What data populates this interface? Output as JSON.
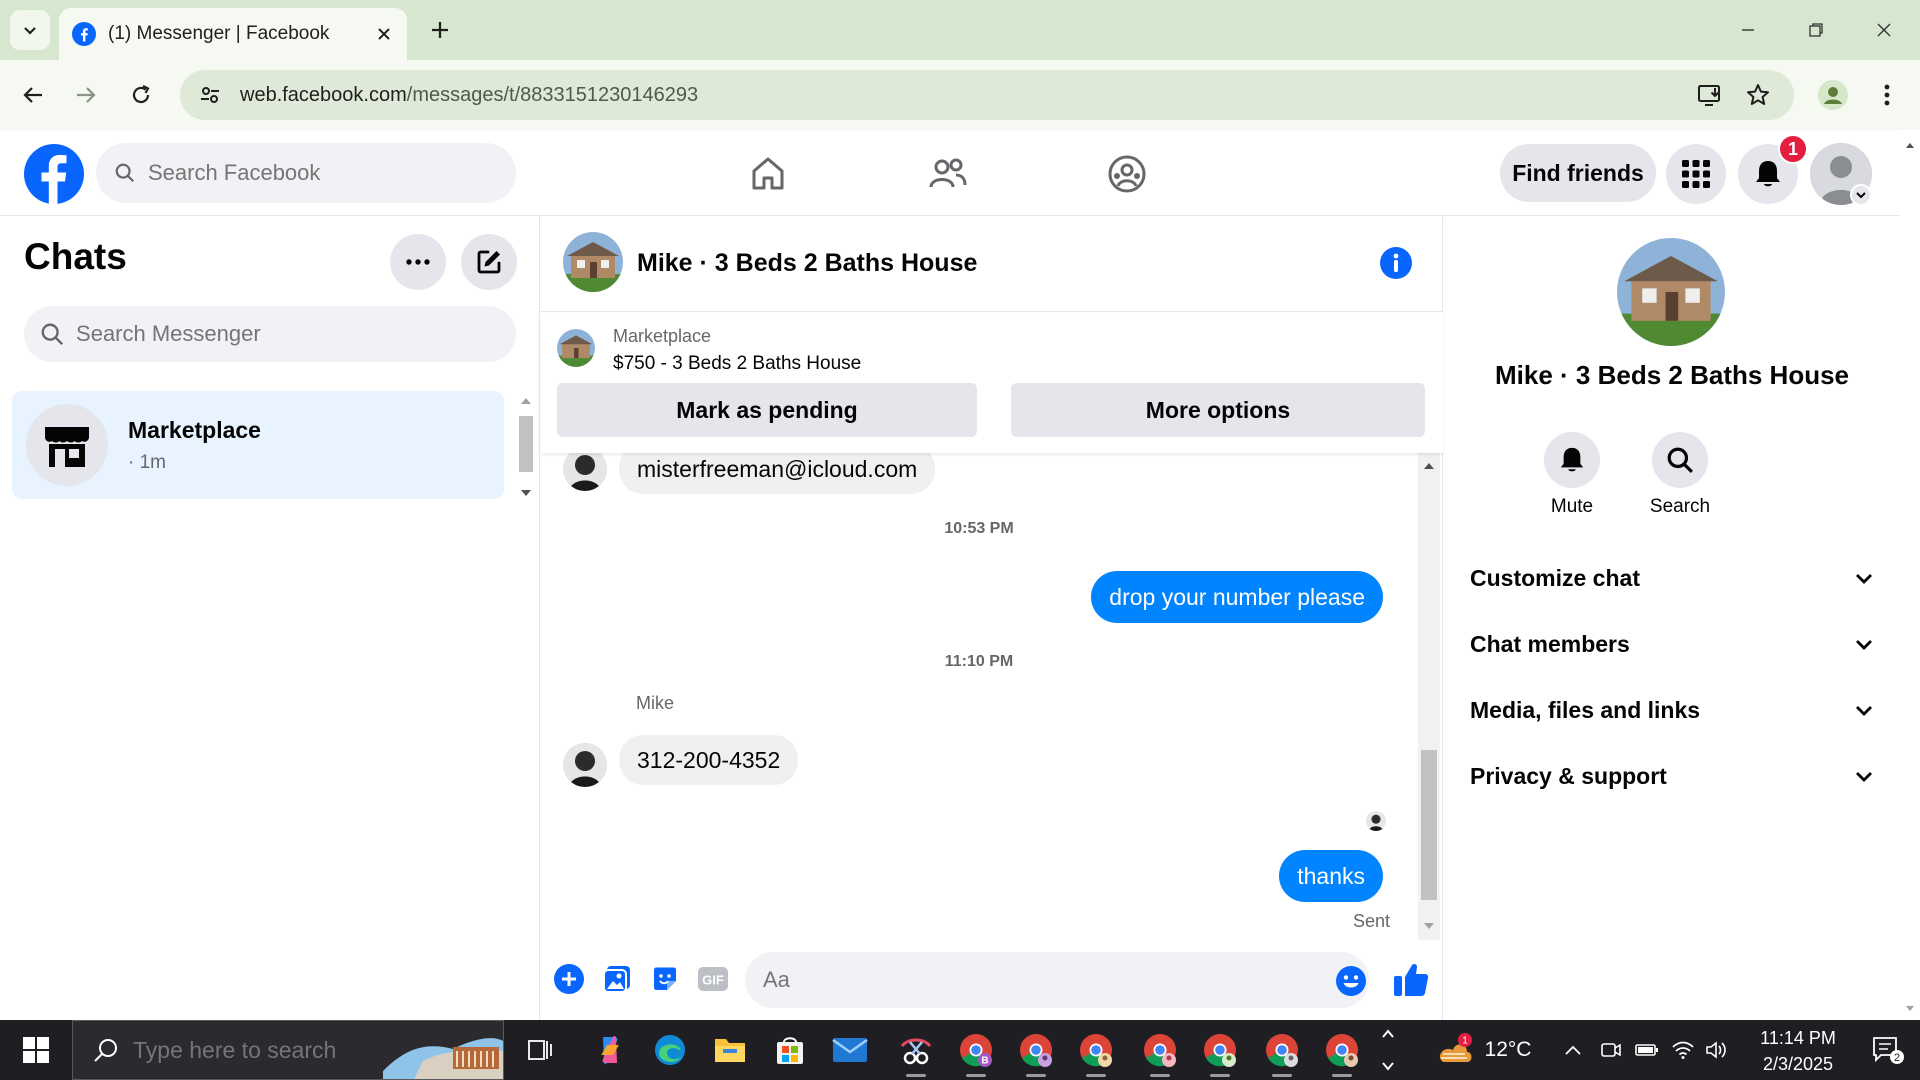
{
  "browser": {
    "tab_title": "(1) Messenger | Facebook",
    "url_host": "web.facebook.com",
    "url_path": "/messages/t/8833151230146293"
  },
  "fb_header": {
    "search_placeholder": "Search Facebook",
    "find_friends_label": "Find friends",
    "notification_count": "1",
    "brand_color": "#0866ff"
  },
  "chats": {
    "title": "Chats",
    "search_placeholder": "Search Messenger",
    "items": [
      {
        "name": "Marketplace",
        "time": "· 1m"
      }
    ]
  },
  "conversation": {
    "title": "Mike · 3 Beds 2 Baths House",
    "marketplace_label": "Marketplace",
    "listing": "$750 - 3 Beds 2 Baths House",
    "mark_pending_label": "Mark as pending",
    "more_options_label": "More options",
    "messages": [
      {
        "direction": "incoming",
        "text": "misterfreeman@icloud.com"
      },
      {
        "type": "timestamp",
        "text": "10:53 PM"
      },
      {
        "direction": "outgoing",
        "text": "drop your number please"
      },
      {
        "type": "timestamp",
        "text": "11:10 PM"
      },
      {
        "direction": "incoming",
        "sender": "Mike",
        "text": "312-200-4352"
      },
      {
        "direction": "outgoing",
        "text": "thanks",
        "status": "Sent"
      }
    ],
    "composer_placeholder": "Aa",
    "outgoing_color": "#0084ff"
  },
  "info_panel": {
    "name": "Mike · 3 Beds 2 Baths House",
    "actions": [
      {
        "label": "Mute",
        "icon": "bell-icon"
      },
      {
        "label": "Search",
        "icon": "search-icon"
      }
    ],
    "sections": [
      {
        "label": "Customize chat"
      },
      {
        "label": "Chat members"
      },
      {
        "label": "Media, files and links"
      },
      {
        "label": "Privacy & support"
      }
    ]
  },
  "taskbar": {
    "search_placeholder": "Type here to search",
    "weather_temp": "12°C",
    "weather_badge": "1",
    "time": "11:14 PM",
    "date": "2/3/2025",
    "notification_count": "2"
  }
}
